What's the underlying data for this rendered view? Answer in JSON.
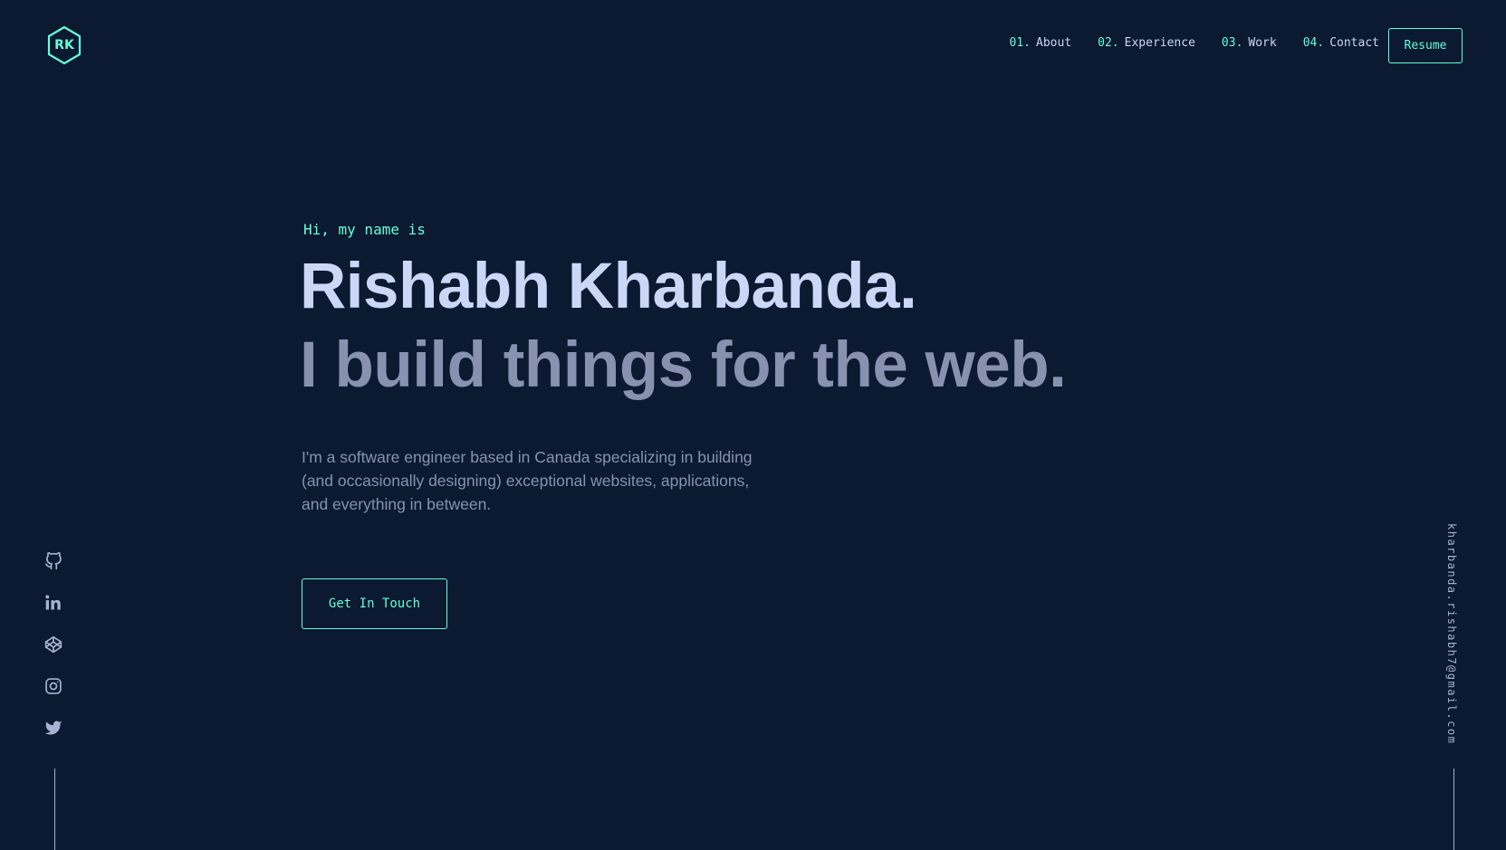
{
  "logo": {
    "text": "RK"
  },
  "nav": {
    "items": [
      {
        "num": "01.",
        "label": "About"
      },
      {
        "num": "02.",
        "label": "Experience"
      },
      {
        "num": "03.",
        "label": "Work"
      },
      {
        "num": "04.",
        "label": "Contact"
      }
    ],
    "resume_label": "Resume"
  },
  "hero": {
    "greeting": "Hi, my name is",
    "name": "Rishabh Kharbanda.",
    "tagline": "I build things for the web.",
    "bio": "I'm a software engineer based in Canada specializing in building (and occasionally designing) exceptional websites, applications, and everything in between.",
    "cta_label": "Get In Touch"
  },
  "social": {
    "icons": [
      "github-icon",
      "linkedin-icon",
      "codepen-icon",
      "instagram-icon",
      "twitter-icon"
    ]
  },
  "email": "kharbanda.rishabh7@gmail.com",
  "colors": {
    "background": "#0b1931",
    "accent": "#64ffda",
    "heading": "#ccd6f6",
    "text": "#8892b0"
  }
}
